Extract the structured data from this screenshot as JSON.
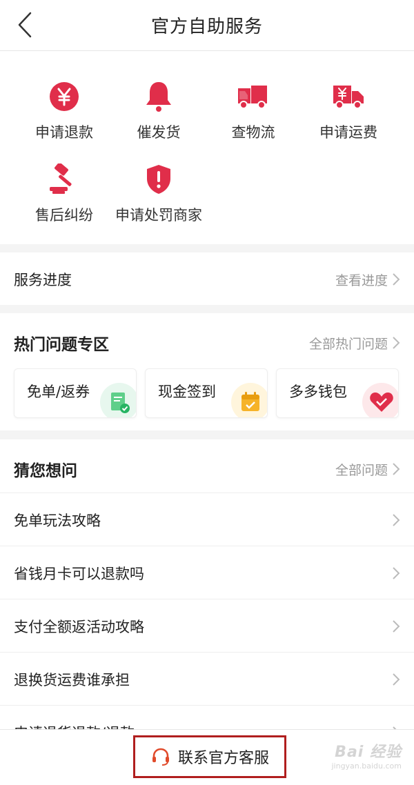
{
  "header": {
    "title": "官方自助服务"
  },
  "services": [
    {
      "label": "申请退款",
      "icon": "yuan-circle-icon"
    },
    {
      "label": "催发货",
      "icon": "bell-icon"
    },
    {
      "label": "查物流",
      "icon": "truck-icon"
    },
    {
      "label": "申请运费",
      "icon": "truck-yuan-icon"
    },
    {
      "label": "售后纠纷",
      "icon": "gavel-icon"
    },
    {
      "label": "申请处罚商家",
      "icon": "shield-alert-icon"
    }
  ],
  "progress": {
    "label": "服务进度",
    "link": "查看进度"
  },
  "hot": {
    "title": "热门问题专区",
    "link": "全部热门问题",
    "cards": [
      {
        "label": "免单/返券",
        "icon": "document-check-icon"
      },
      {
        "label": "现金签到",
        "icon": "calendar-check-icon"
      },
      {
        "label": "多多钱包",
        "icon": "heart-wallet-icon"
      }
    ]
  },
  "faq": {
    "title": "猜您想问",
    "link": "全部问题",
    "items": [
      "免单玩法攻略",
      "省钱月卡可以退款吗",
      "支付全额返活动攻略",
      "退换货运费谁承担",
      "申请退货退款/退款"
    ]
  },
  "bottom": {
    "contact_label": "联系官方客服",
    "watermark_top": "Bai 经验",
    "watermark_sub": "jingyan.baidu.com"
  },
  "colors": {
    "accent": "#e02e4a",
    "green": "#27b463",
    "orange": "#f6b329"
  }
}
